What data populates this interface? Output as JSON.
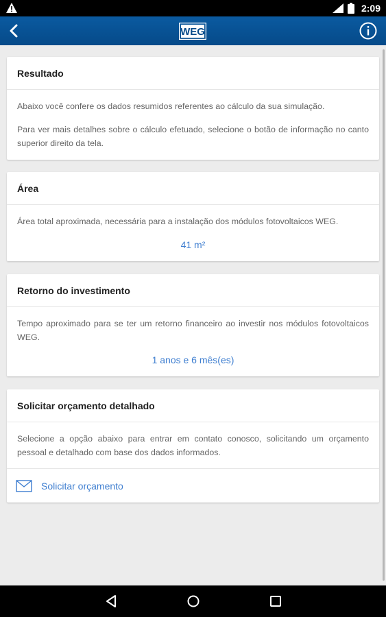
{
  "status_bar": {
    "time": "2:09",
    "icons": [
      "warning-icon",
      "wifi-icon",
      "battery-icon"
    ]
  },
  "app_bar": {
    "logo_text": "WEG",
    "icons": [
      "back-arrow-icon",
      "info-icon"
    ],
    "color": "#0a5aa0"
  },
  "cards": {
    "resultado": {
      "title": "Resultado",
      "paragraph1": "Abaixo você confere os dados resumidos referentes ao cálculo da sua simulação.",
      "paragraph2": "Para ver mais detalhes sobre o cálculo efetuado, selecione o botão de informação no canto superior direito da tela."
    },
    "area": {
      "title": "Área",
      "description": "Área total aproximada, necessária para a instalação dos módulos fotovoltaicos WEG.",
      "value": "41 m²"
    },
    "retorno": {
      "title": "Retorno do investimento",
      "description": "Tempo aproximado para se ter um retorno financeiro ao investir nos módulos fotovoltaicos WEG.",
      "value": "1 anos e 6 mês(es)"
    },
    "orcamento": {
      "title": "Solicitar orçamento detalhado",
      "description": "Selecione a opção abaixo para entrar em contato conosco, solicitando um orçamento pessoal e detalhado com base dos dados informados.",
      "action_label": "Solicitar orçamento",
      "action_icon": "mail-icon"
    }
  },
  "nav_bar": {
    "icons": [
      "back-triangle-icon",
      "home-circle-icon",
      "recents-square-icon"
    ]
  },
  "colors": {
    "accent": "#3e7ed0",
    "background": "#ececec"
  }
}
